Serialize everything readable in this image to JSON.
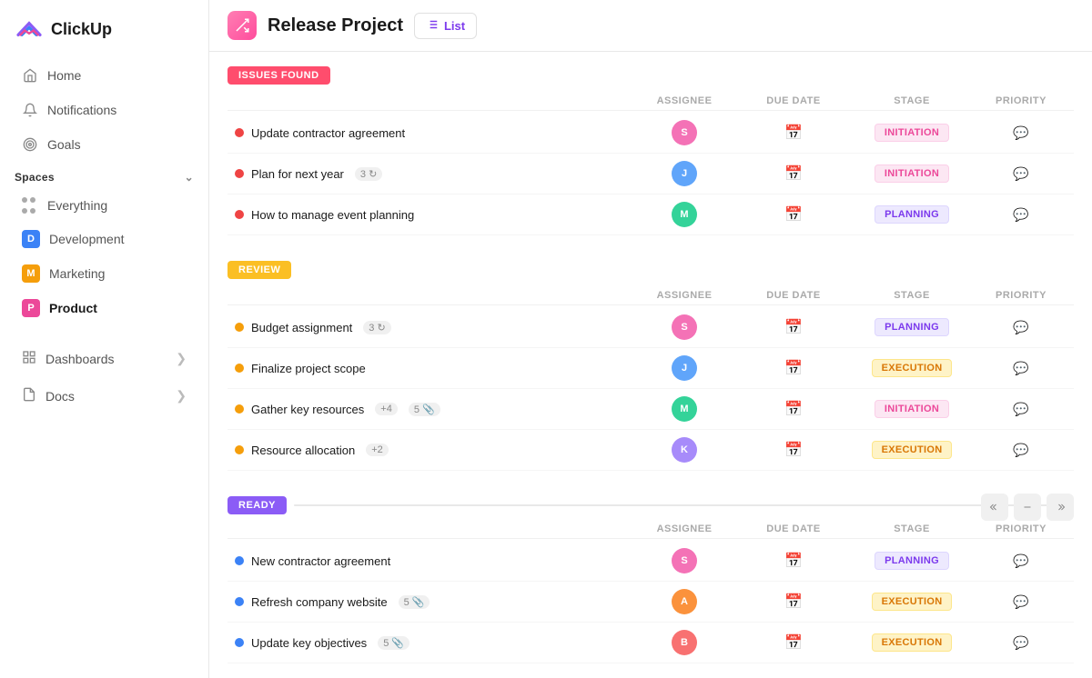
{
  "sidebar": {
    "logo": "ClickUp",
    "nav": [
      {
        "id": "home",
        "label": "Home",
        "icon": "🏠"
      },
      {
        "id": "notifications",
        "label": "Notifications",
        "icon": "🔔"
      },
      {
        "id": "goals",
        "label": "Goals",
        "icon": "🎯"
      }
    ],
    "spaces_label": "Spaces",
    "spaces": [
      {
        "id": "everything",
        "label": "Everything",
        "icon": "dots",
        "color": null
      },
      {
        "id": "development",
        "label": "Development",
        "initial": "D",
        "color": "#3b82f6"
      },
      {
        "id": "marketing",
        "label": "Marketing",
        "initial": "M",
        "color": "#f59e0b"
      },
      {
        "id": "product",
        "label": "Product",
        "initial": "P",
        "color": "#ec4899",
        "active": true
      }
    ],
    "dashboards_label": "Dashboards",
    "docs_label": "Docs"
  },
  "header": {
    "project_title": "Release Project",
    "view_label": "List"
  },
  "sections": [
    {
      "id": "issues",
      "label": "ISSUES FOUND",
      "label_class": "label-issues",
      "columns": [
        "ASSIGNEE",
        "DUE DATE",
        "STAGE",
        "PRIORITY"
      ],
      "tasks": [
        {
          "name": "Update contractor agreement",
          "priority_color": "dot-red",
          "assignee_initial": "S",
          "assignee_color": "av1",
          "stage": "INITIATION",
          "stage_class": "stage-initiation",
          "badges": []
        },
        {
          "name": "Plan for next year",
          "priority_color": "dot-red",
          "assignee_initial": "J",
          "assignee_color": "av2",
          "stage": "INITIATION",
          "stage_class": "stage-initiation",
          "badges": [
            {
              "label": "3",
              "icon": "↻"
            }
          ]
        },
        {
          "name": "How to manage event planning",
          "priority_color": "dot-red",
          "assignee_initial": "M",
          "assignee_color": "av3",
          "stage": "PLANNING",
          "stage_class": "stage-planning",
          "badges": []
        }
      ]
    },
    {
      "id": "review",
      "label": "REVIEW",
      "label_class": "label-review",
      "columns": [
        "ASSIGNEE",
        "DUE DATE",
        "STAGE",
        "PRIORITY"
      ],
      "tasks": [
        {
          "name": "Budget assignment",
          "priority_color": "dot-yellow",
          "assignee_initial": "S",
          "assignee_color": "av1",
          "stage": "PLANNING",
          "stage_class": "stage-planning",
          "badges": [
            {
              "label": "3",
              "icon": "↻"
            }
          ]
        },
        {
          "name": "Finalize project scope",
          "priority_color": "dot-yellow",
          "assignee_initial": "J",
          "assignee_color": "av2",
          "stage": "EXECUTION",
          "stage_class": "stage-execution",
          "badges": []
        },
        {
          "name": "Gather key resources",
          "priority_color": "dot-yellow",
          "assignee_initial": "M",
          "assignee_color": "av3",
          "stage": "INITIATION",
          "stage_class": "stage-initiation",
          "badges": [
            {
              "label": "+4",
              "icon": ""
            },
            {
              "label": "5",
              "icon": "📎"
            }
          ]
        },
        {
          "name": "Resource allocation",
          "priority_color": "dot-yellow",
          "assignee_initial": "K",
          "assignee_color": "av4",
          "stage": "EXECUTION",
          "stage_class": "stage-execution",
          "badges": [
            {
              "label": "+2",
              "icon": ""
            }
          ]
        }
      ]
    },
    {
      "id": "ready",
      "label": "READY",
      "label_class": "label-ready",
      "columns": [
        "ASSIGNEE",
        "DUE DATE",
        "STAGE",
        "PRIORITY"
      ],
      "tasks": [
        {
          "name": "New contractor agreement",
          "priority_color": "dot-blue",
          "assignee_initial": "S",
          "assignee_color": "av1",
          "stage": "PLANNING",
          "stage_class": "stage-planning",
          "badges": []
        },
        {
          "name": "Refresh company website",
          "priority_color": "dot-blue",
          "assignee_initial": "A",
          "assignee_color": "av5",
          "stage": "EXECUTION",
          "stage_class": "stage-execution",
          "badges": [
            {
              "label": "5",
              "icon": "📎"
            }
          ]
        },
        {
          "name": "Update key objectives",
          "priority_color": "dot-blue",
          "assignee_initial": "B",
          "assignee_color": "av6",
          "stage": "EXECUTION",
          "stage_class": "stage-execution",
          "badges": [
            {
              "label": "5",
              "icon": "📎"
            }
          ]
        }
      ]
    }
  ]
}
